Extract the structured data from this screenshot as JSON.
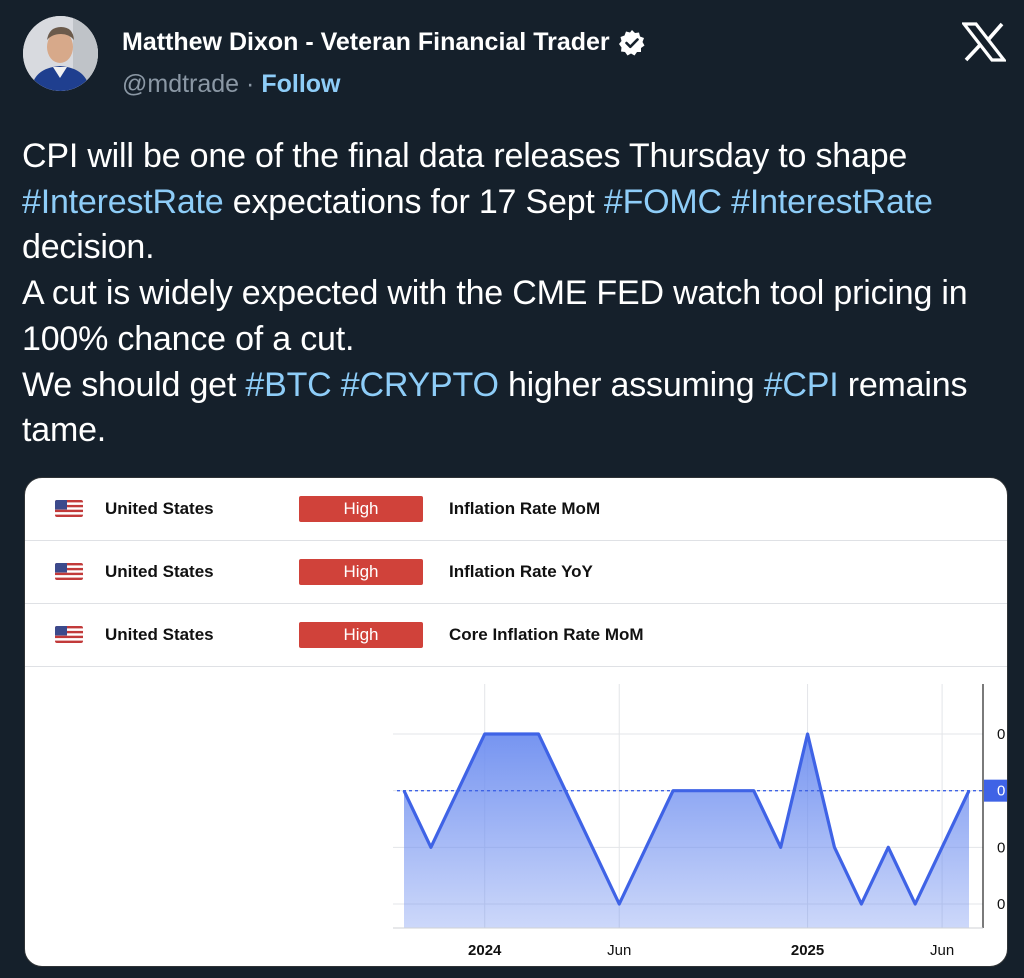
{
  "header": {
    "display_name": "Matthew Dixon - Veteran Financial Trader",
    "handle": "@mdtrade",
    "separator": "·",
    "follow_label": "Follow"
  },
  "tweet": {
    "segments": [
      {
        "text": "CPI will be one of the final data releases Thursday to shape ",
        "tag": false
      },
      {
        "text": "#InterestRate",
        "tag": true
      },
      {
        "text": " expectations for 17 Sept  ",
        "tag": false
      },
      {
        "text": "#FOMC",
        "tag": true
      },
      {
        "text": " ",
        "tag": false
      },
      {
        "text": "#InterestRate",
        "tag": true
      },
      {
        "text": " decision.",
        "tag": false
      },
      {
        "text": "\n",
        "tag": false
      },
      {
        "text": "A cut is widely expected with the CME FED watch tool pricing in 100% chance of a cut.",
        "tag": false
      },
      {
        "text": "\n",
        "tag": false
      },
      {
        "text": "We should get ",
        "tag": false
      },
      {
        "text": "#BTC",
        "tag": true
      },
      {
        "text": " ",
        "tag": false
      },
      {
        "text": "#CRYPTO",
        "tag": true
      },
      {
        "text": " higher assuming ",
        "tag": false
      },
      {
        "text": "#CPI",
        "tag": true
      },
      {
        "text": " remains tame.",
        "tag": false
      }
    ]
  },
  "calendar": {
    "rows": [
      {
        "country": "United States",
        "impact": "High",
        "event": "Inflation Rate MoM"
      },
      {
        "country": "United States",
        "impact": "High",
        "event": "Inflation Rate YoY"
      },
      {
        "country": "United States",
        "impact": "High",
        "event": "Core Inflation Rate MoM"
      }
    ]
  },
  "colors": {
    "background": "#15202b",
    "hashtag": "#8ecdf8",
    "impact_high": "#d0423a",
    "line": "#3f63e6",
    "area": "#6f8ff0"
  },
  "chart_data": {
    "type": "area",
    "x": [
      "2023-10",
      "2023-11",
      "2023-12",
      "2024-01",
      "2024-02",
      "2024-03",
      "2024-04",
      "2024-05",
      "2024-06",
      "2024-07",
      "2024-08",
      "2024-09",
      "2024-10",
      "2024-11",
      "2024-12",
      "2025-01",
      "2025-02",
      "2025-03",
      "2025-04",
      "2025-05",
      "2025-06",
      "2025-07"
    ],
    "values": [
      0.3,
      0.2,
      0.3,
      0.4,
      0.4,
      0.4,
      0.3,
      0.2,
      0.1,
      0.2,
      0.3,
      0.3,
      0.3,
      0.3,
      0.2,
      0.4,
      0.2,
      0.1,
      0.2,
      0.1,
      0.2,
      0.3
    ],
    "x_tick_labels": [
      "2024",
      "Jun",
      "2025",
      "Jun"
    ],
    "y_tick_labels": [
      "0",
      "0",
      "0",
      "0"
    ],
    "current_value_label": "0",
    "reference_line": 0.3,
    "ylim": [
      0.1,
      0.4
    ],
    "grid": true
  }
}
